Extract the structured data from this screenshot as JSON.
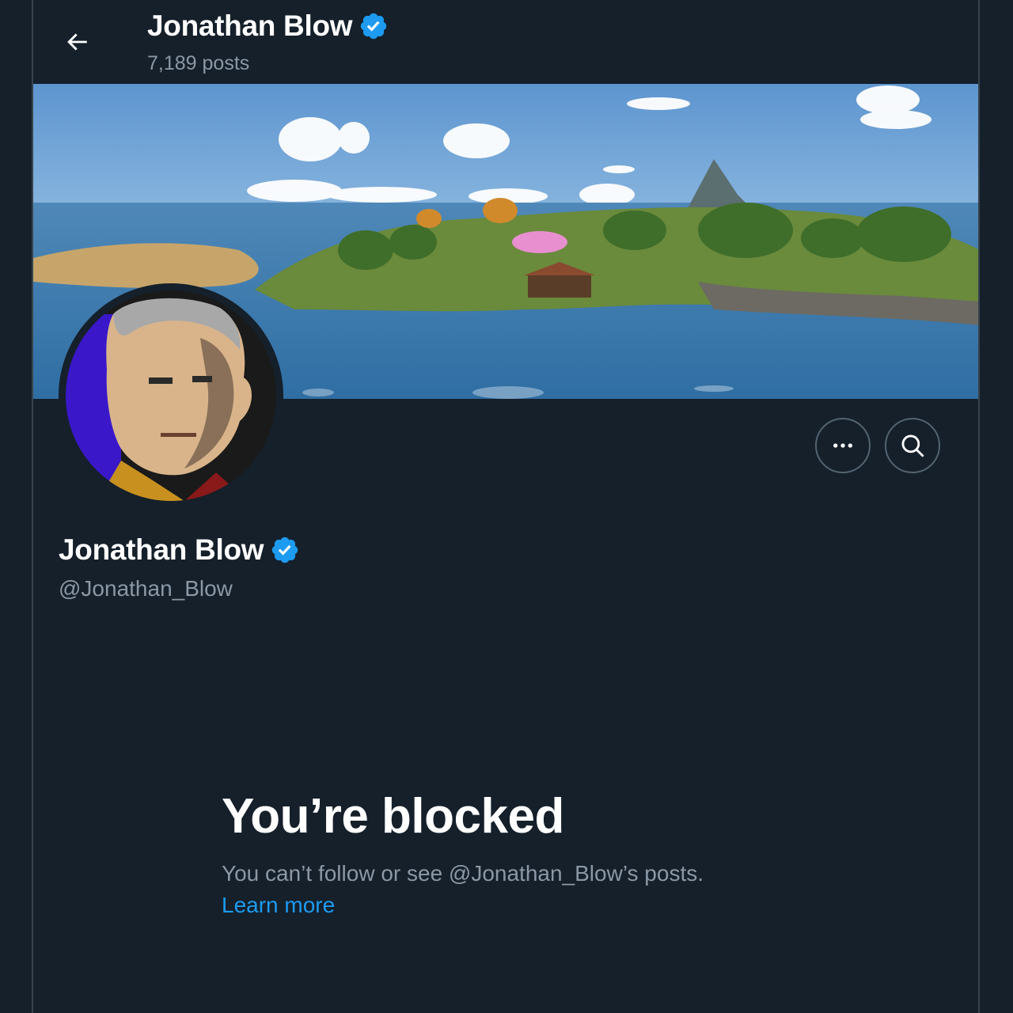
{
  "header": {
    "name": "Jonathan Blow",
    "posts_count": "7,189 posts"
  },
  "profile": {
    "name": "Jonathan Blow",
    "handle": "@Jonathan_Blow",
    "verified": true
  },
  "blocked": {
    "title": "You’re blocked",
    "message": "You can’t follow or see @Jonathan_Blow’s posts.",
    "link": "Learn more"
  },
  "icons": {
    "back": "arrow-left-icon",
    "verified": "verified-badge-icon",
    "more": "more-horizontal-icon",
    "search": "search-icon"
  },
  "colors": {
    "background": "#15202b",
    "accent": "#1d9bf0",
    "secondary_text": "#8b98a5",
    "border": "#38444d"
  }
}
